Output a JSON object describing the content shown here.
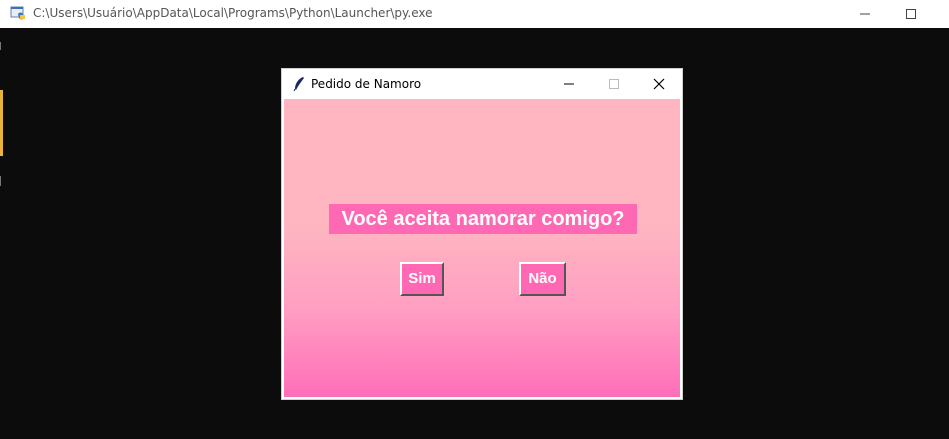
{
  "console": {
    "title": "C:\\Users\\Usuário\\AppData\\Local\\Programs\\Python\\Launcher\\py.exe",
    "icon": "python-launcher-icon",
    "background_color": "#0c0c0c"
  },
  "dialog": {
    "title": "Pedido de Namoro",
    "icon": "tk-feather-icon",
    "question": "Você aceita namorar comigo?",
    "buttons": {
      "yes_label": "Sim",
      "no_label": "Não"
    },
    "colors": {
      "background_top": "#ffb6c1",
      "background_bottom": "#ff6eb9",
      "accent": "#ff69b4",
      "text": "#ffffff"
    }
  }
}
